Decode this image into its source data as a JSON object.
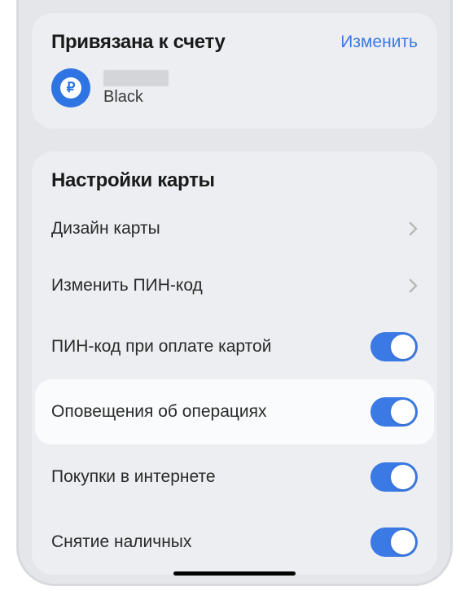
{
  "account": {
    "title": "Привязана к счету",
    "change_label": "Изменить",
    "type_label": "Black",
    "currency_symbol": "₽"
  },
  "settings": {
    "title": "Настройки карты",
    "rows": [
      {
        "label": "Дизайн карты",
        "kind": "link"
      },
      {
        "label": "Изменить ПИН-код",
        "kind": "link"
      },
      {
        "label": "ПИН-код при оплате картой",
        "kind": "toggle",
        "on": true
      },
      {
        "label": "Оповещения об операциях",
        "kind": "toggle",
        "on": true,
        "highlighted": true
      },
      {
        "label": "Покупки в интернете",
        "kind": "toggle",
        "on": true
      },
      {
        "label": "Снятие наличных",
        "kind": "toggle",
        "on": true
      }
    ]
  }
}
